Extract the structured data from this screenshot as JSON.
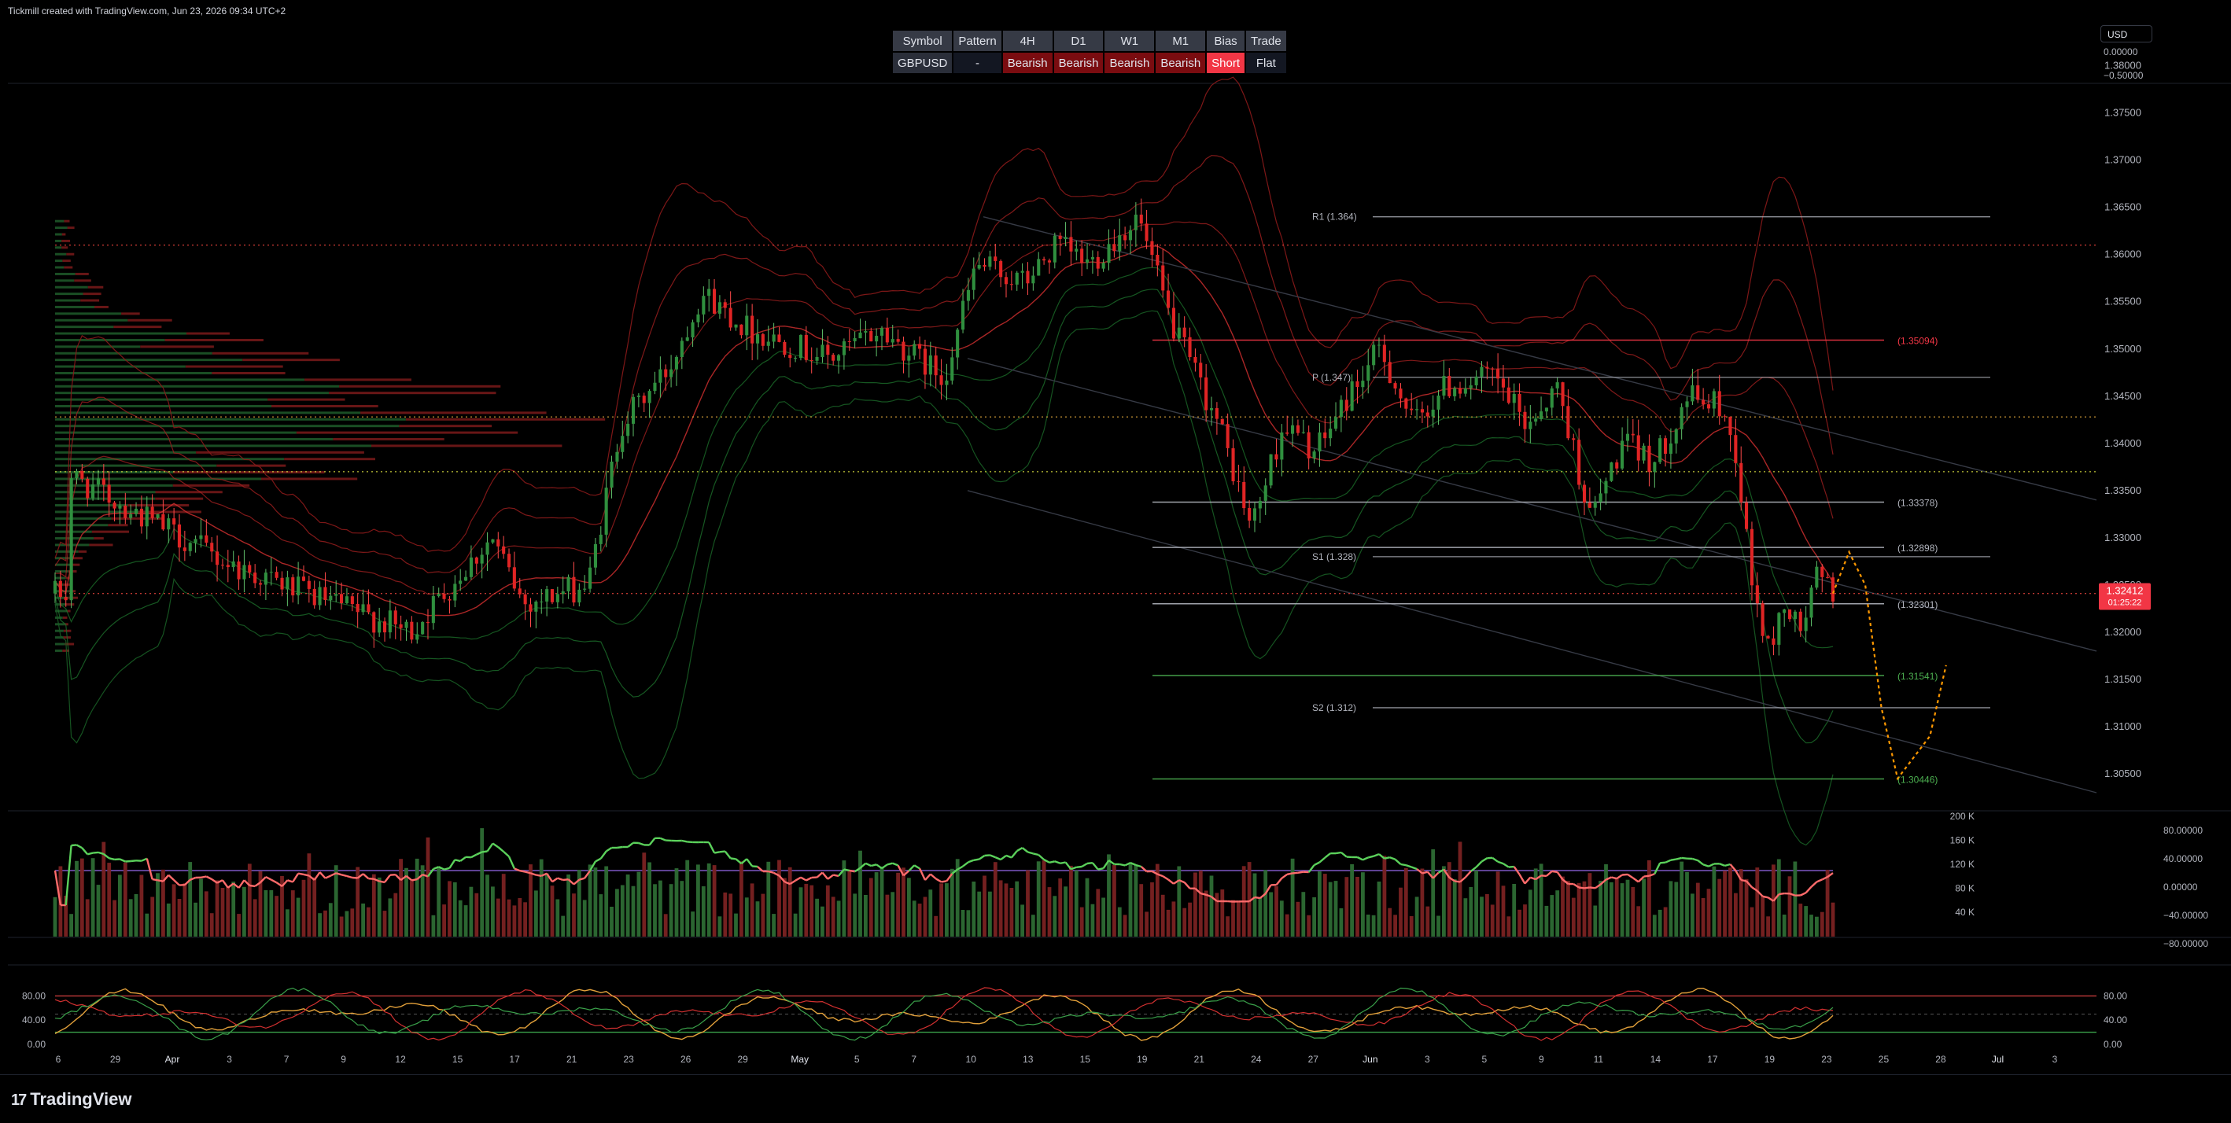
{
  "header": {
    "caption": "Tickmill created with TradingView.com, Jun 23, 2026 09:34 UTC+2"
  },
  "signal_table": {
    "headers": [
      "Symbol",
      "Pattern",
      "4H",
      "D1",
      "W1",
      "M1",
      "Bias",
      "Trade"
    ],
    "row": [
      "GBPUSD",
      "-",
      "Bearish",
      "Bearish",
      "Bearish",
      "Bearish",
      "Short",
      "Flat"
    ]
  },
  "top_scale": {
    "currency": "USD",
    "values": [
      "0.00000",
      "−0.50000"
    ]
  },
  "footer": {
    "logo_mark": "17",
    "logo_text": "TradingView"
  },
  "colors": {
    "bull": "#2f8f3e",
    "bear": "#e02424",
    "rsi_up": "#5bd15b",
    "rsi_down": "#ff6b6b",
    "pivot_line": "#b2b5be",
    "red_level": "#f23645",
    "green_level": "#4caf50",
    "projection": "#ff9800",
    "grid": "#1e222d"
  },
  "chart_data": [
    {
      "type": "candlestick",
      "symbol": "GBPUSD",
      "price_axis_ticks": [
        "1.38000",
        "1.37500",
        "1.37000",
        "1.36500",
        "1.36000",
        "1.35500",
        "1.35000",
        "1.34500",
        "1.34000",
        "1.33500",
        "1.33000",
        "1.32500",
        "1.32000",
        "1.31500",
        "1.31000",
        "1.30500"
      ],
      "ylim": [
        1.3015,
        1.3818
      ],
      "x_tick_labels": [
        "6",
        "29",
        "Apr",
        "3",
        "7",
        "9",
        "12",
        "15",
        "17",
        "21",
        "23",
        "26",
        "29",
        "May",
        "5",
        "7",
        "10",
        "13",
        "15",
        "19",
        "21",
        "24",
        "27",
        "Jun",
        "3",
        "5",
        "9",
        "11",
        "14",
        "17",
        "19",
        "23",
        "25",
        "28",
        "Jul",
        "3"
      ],
      "last_price": {
        "value": "1.32412",
        "countdown": "01:25:22"
      },
      "approx_close_path": [
        {
          "date": "Mar 6",
          "close": 1.3365
        },
        {
          "date": "Mar 16",
          "close": 1.327
        },
        {
          "date": "Mar 27",
          "close": 1.32
        },
        {
          "date": "Apr 1",
          "close": 1.33
        },
        {
          "date": "Apr 3",
          "close": 1.323
        },
        {
          "date": "Apr 7",
          "close": 1.325
        },
        {
          "date": "Apr 9",
          "close": 1.342
        },
        {
          "date": "Apr 12",
          "close": 1.348
        },
        {
          "date": "Apr 14",
          "close": 1.356
        },
        {
          "date": "Apr 17",
          "close": 1.352
        },
        {
          "date": "Apr 22",
          "close": 1.349
        },
        {
          "date": "Apr 25",
          "close": 1.352
        },
        {
          "date": "Apr 29",
          "close": 1.347
        },
        {
          "date": "May 1",
          "close": 1.359
        },
        {
          "date": "May 4",
          "close": 1.357
        },
        {
          "date": "May 6",
          "close": 1.361
        },
        {
          "date": "May 8",
          "close": 1.359
        },
        {
          "date": "May 11",
          "close": 1.364
        },
        {
          "date": "May 13",
          "close": 1.353
        },
        {
          "date": "May 16",
          "close": 1.342
        },
        {
          "date": "May 18",
          "close": 1.331
        },
        {
          "date": "May 20",
          "close": 1.342
        },
        {
          "date": "May 22",
          "close": 1.339
        },
        {
          "date": "May 24",
          "close": 1.345
        },
        {
          "date": "May 26",
          "close": 1.35
        },
        {
          "date": "May 28",
          "close": 1.342
        },
        {
          "date": "May 30",
          "close": 1.346
        },
        {
          "date": "Jun 2",
          "close": 1.347
        },
        {
          "date": "Jun 4",
          "close": 1.342
        },
        {
          "date": "Jun 6",
          "close": 1.346
        },
        {
          "date": "Jun 8",
          "close": 1.332
        },
        {
          "date": "Jun 10",
          "close": 1.34
        },
        {
          "date": "Jun 12",
          "close": 1.338
        },
        {
          "date": "Jun 14",
          "close": 1.345
        },
        {
          "date": "Jun 16",
          "close": 1.344
        },
        {
          "date": "Jun 17",
          "close": 1.339
        },
        {
          "date": "Jun 18",
          "close": 1.325
        },
        {
          "date": "Jun 19",
          "close": 1.318
        },
        {
          "date": "Jun 20",
          "close": 1.323
        },
        {
          "date": "Jun 21",
          "close": 1.32
        },
        {
          "date": "Jun 22",
          "close": 1.326
        },
        {
          "date": "Jun 23",
          "close": 1.3241
        }
      ],
      "pivot_levels": [
        {
          "label": "R1 (1.364)",
          "value": 1.364
        },
        {
          "label": "P (1.347)",
          "value": 1.347
        },
        {
          "label": "S1 (1.328)",
          "value": 1.328
        },
        {
          "label": "S2 (1.312)",
          "value": 1.312
        }
      ],
      "price_levels": [
        {
          "label": "(1.35094)",
          "value": 1.35094,
          "kind": "resistance"
        },
        {
          "label": "(1.33378)",
          "value": 1.33378,
          "kind": "neutral"
        },
        {
          "label": "(1.32898)",
          "value": 1.32898,
          "kind": "neutral"
        },
        {
          "label": "(1.32301)",
          "value": 1.32301,
          "kind": "neutral"
        },
        {
          "label": "(1.31541)",
          "value": 1.31541,
          "kind": "support"
        },
        {
          "label": "(1.30446)",
          "value": 1.30446,
          "kind": "support"
        }
      ],
      "horizontal_dotted_levels": [
        1.361,
        1.3428,
        1.337,
        1.3241
      ],
      "projection_path": [
        {
          "date": "Jun 23",
          "value": 1.3241
        },
        {
          "date": "Jun 24",
          "value": 1.3285
        },
        {
          "date": "Jun 25",
          "value": 1.325
        },
        {
          "date": "Jun 26",
          "value": 1.312
        },
        {
          "date": "Jun 27",
          "value": 1.3045
        },
        {
          "date": "Jun 29",
          "value": 1.309
        },
        {
          "date": "Jun 30",
          "value": 1.3165
        }
      ]
    },
    {
      "type": "bar+line",
      "panel": "volume_rsi",
      "left_axis_ticks": [
        "200 K",
        "160 K",
        "120 K",
        "80 K",
        "40 K"
      ],
      "right_axis_ticks": [
        "80.00000",
        "40.00000",
        "0.00000",
        "−40.00000",
        "−80.00000"
      ]
    },
    {
      "type": "line",
      "panel": "stochastic",
      "axis_ticks": [
        "80.00",
        "40.00",
        "0.00"
      ],
      "right_axis_ticks": [
        "80.00",
        "40.00",
        "0.00"
      ],
      "overbought": 80,
      "oversold": 20
    }
  ]
}
